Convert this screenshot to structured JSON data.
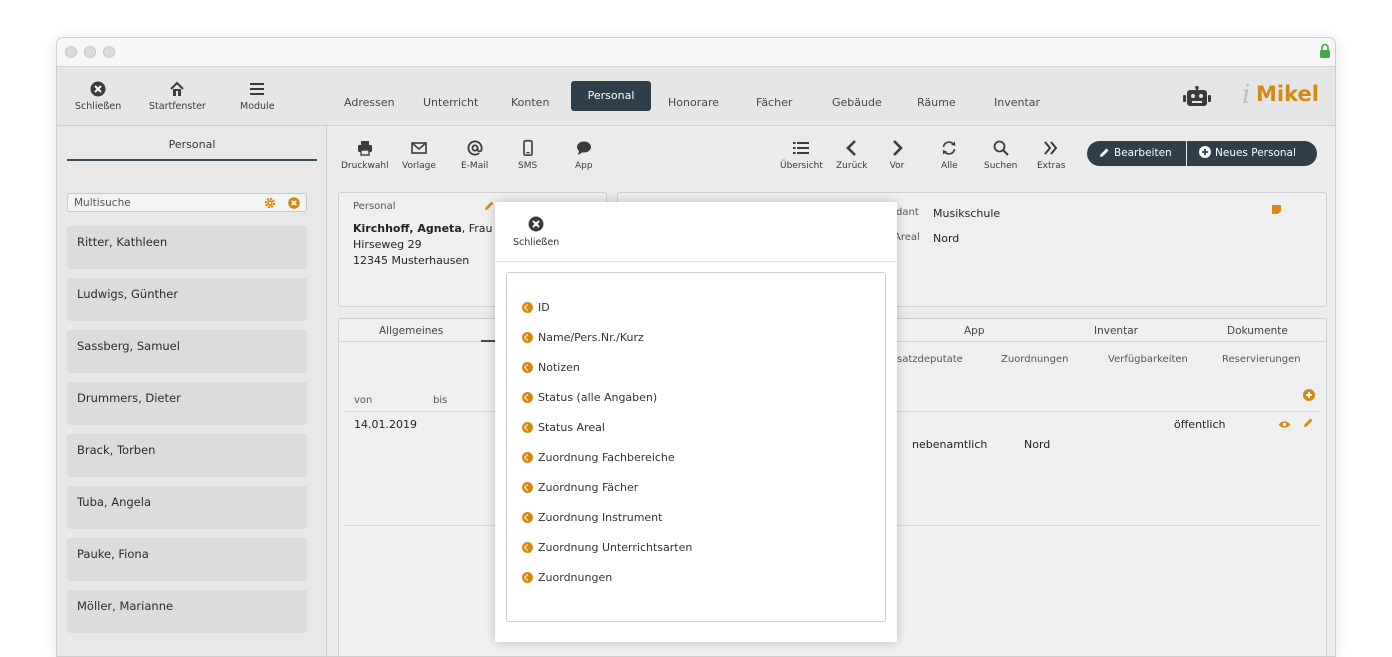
{
  "topbar": {
    "buttons": [
      {
        "label": "Schließen",
        "icon": "close-circle-icon"
      },
      {
        "label": "Startfenster",
        "icon": "home-icon"
      },
      {
        "label": "Module",
        "icon": "menu-icon"
      }
    ],
    "nav": [
      "Adressen",
      "Unterricht",
      "Konten",
      "Personal",
      "Honorare",
      "Fächer",
      "Gebäude",
      "Räume",
      "Inventar"
    ],
    "active_nav": "Personal",
    "logo_text": "Mikel",
    "logo_prefix": "i",
    "robot_icon": "robot-icon"
  },
  "sidebar": {
    "title": "Personal",
    "search_placeholder": "Multisuche",
    "people": [
      "Ritter, Kathleen",
      "Ludwigs, Günther",
      "Sassberg, Samuel",
      "Drummers, Dieter",
      "Brack, Torben",
      "Tuba, Angela",
      "Pauke, Fiona",
      "Möller, Marianne"
    ]
  },
  "toolbar": {
    "left": [
      {
        "label": "Druckwahl",
        "icon": "printer-icon"
      },
      {
        "label": "Vorlage",
        "icon": "envelope-icon"
      },
      {
        "label": "E-Mail",
        "icon": "at-icon"
      },
      {
        "label": "SMS",
        "icon": "phone-icon"
      },
      {
        "label": "App",
        "icon": "chat-bubble-icon"
      }
    ],
    "right": [
      {
        "label": "Übersicht",
        "icon": "list-icon"
      },
      {
        "label": "Zurück",
        "icon": "chevron-left-icon"
      },
      {
        "label": "Vor",
        "icon": "chevron-right-icon"
      },
      {
        "label": "Alle",
        "icon": "refresh-icon"
      },
      {
        "label": "Suchen",
        "icon": "search-icon"
      },
      {
        "label": "Extras",
        "icon": "double-chevron-icon"
      }
    ],
    "edit_label": "Bearbeiten",
    "new_label": "Neues Personal"
  },
  "person_card": {
    "section": "Personal",
    "name_bold": "Kirchhoff, Agneta",
    "name_rest": ", Frau",
    "street": "Hirseweg 29",
    "city": "12345 Musterhausen"
  },
  "info_card": {
    "label1": "dant",
    "value1": "Musikschule",
    "label2": "Areal",
    "value2": "Nord"
  },
  "tabs": {
    "main": [
      "Allgemeines",
      "App",
      "Inventar",
      "Dokumente"
    ],
    "sub": [
      "satzdeputate",
      "Zuordnungen",
      "Verfügbarkeiten",
      "Reservierungen"
    ]
  },
  "table": {
    "col_von": "von",
    "col_bis": "bis",
    "row_date": "14.01.2019",
    "row_status": "öffentlich",
    "row_type": "nebenamtlich",
    "row_areal": "Nord"
  },
  "overlay": {
    "close_label": "Schließen",
    "options": [
      "ID",
      "Name/Pers.Nr./Kurz",
      "Notizen",
      "Status (alle Angaben)",
      "Status Areal",
      "Zuordnung Fachbereiche",
      "Zuordnung Fächer",
      "Zuordnung Instrument",
      "Zuordnung Unterrichtsarten",
      "Zuordnungen"
    ]
  },
  "colors": {
    "accent": "#d38a12",
    "dark": "#2f3e48",
    "logo": "#d38a12"
  }
}
